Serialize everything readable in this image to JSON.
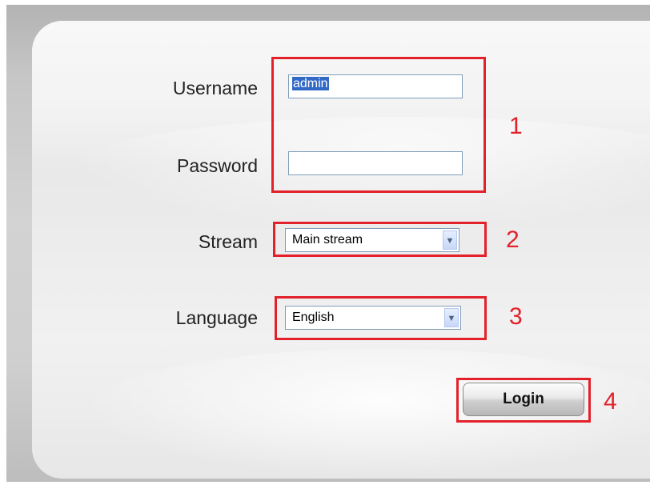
{
  "form": {
    "username_label": "Username",
    "username_value": "admin",
    "password_label": "Password",
    "password_value": "",
    "stream_label": "Stream",
    "stream_value": "Main stream",
    "language_label": "Language",
    "language_value": "English",
    "login_label": "Login"
  },
  "callouts": [
    "1",
    "2",
    "3",
    "4"
  ],
  "colors": {
    "callout": "#e3212b",
    "selection": "#3169c6"
  },
  "icons": {
    "stream_dropdown": "chevron-down-icon",
    "language_dropdown": "chevron-down-icon"
  }
}
